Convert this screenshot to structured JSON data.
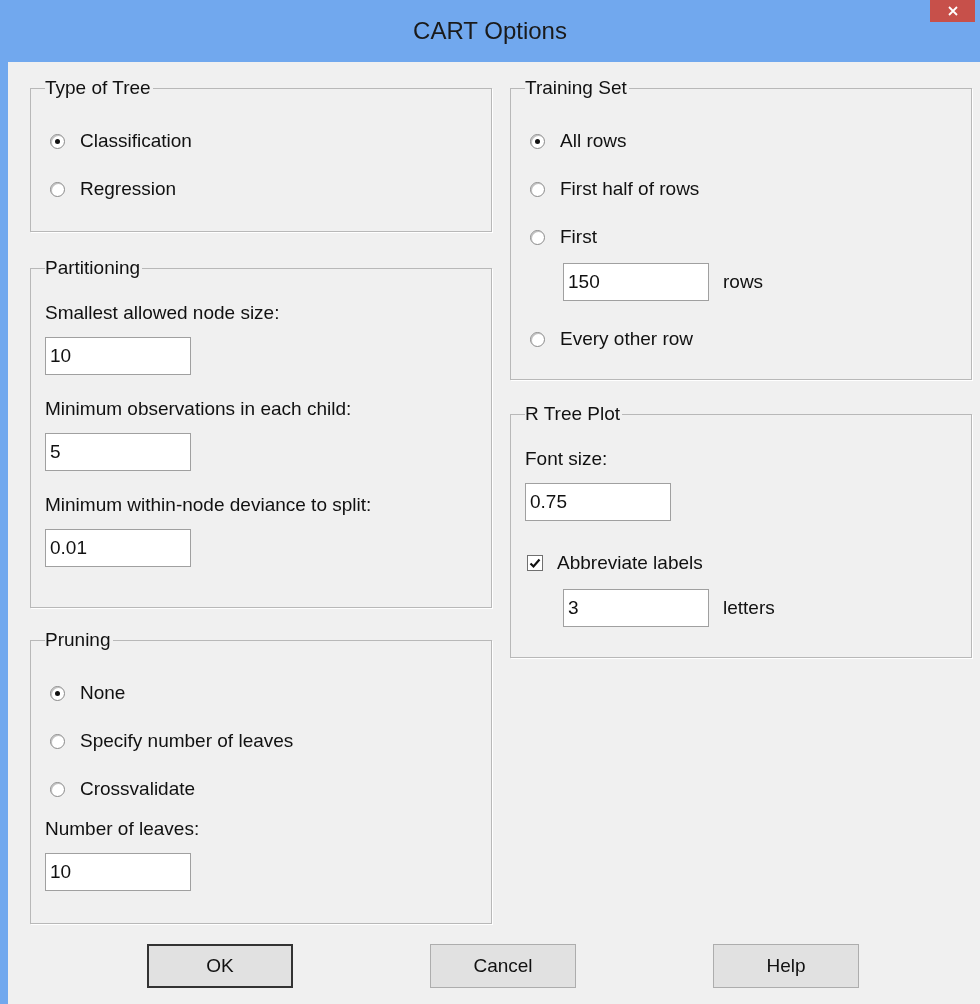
{
  "window": {
    "title": "CART Options"
  },
  "columns": [
    [
      {
        "title": "Type of Tree",
        "items": [
          {
            "kind": "radio",
            "label": "Classification",
            "selected": true
          },
          {
            "kind": "radio",
            "label": "Regression",
            "selected": false
          }
        ]
      },
      {
        "title": "Partitioning",
        "items": [
          {
            "kind": "label",
            "text": "Smallest allowed node size:"
          },
          {
            "kind": "field",
            "value": "10"
          },
          {
            "kind": "label",
            "text": "Minimum observations in each child:"
          },
          {
            "kind": "field",
            "value": "5"
          },
          {
            "kind": "label",
            "text": "Minimum within-node deviance to split:"
          },
          {
            "kind": "field",
            "value": "0.01"
          }
        ]
      },
      {
        "title": "Pruning",
        "items": [
          {
            "kind": "radio",
            "label": "None",
            "selected": true
          },
          {
            "kind": "radio",
            "label": "Specify number of leaves",
            "selected": false
          },
          {
            "kind": "radio",
            "label": "Crossvalidate",
            "selected": false
          },
          {
            "kind": "label",
            "text": "Number of leaves:"
          },
          {
            "kind": "field",
            "value": "10"
          }
        ]
      }
    ],
    [
      {
        "title": "Training Set",
        "items": [
          {
            "kind": "radio",
            "label": "All rows",
            "selected": true
          },
          {
            "kind": "radio",
            "label": "First half of rows",
            "selected": false
          },
          {
            "kind": "radio",
            "label": "First",
            "selected": false
          },
          {
            "kind": "subfield",
            "value": "150",
            "unit": "rows"
          },
          {
            "kind": "radio",
            "label": "Every other row",
            "selected": false
          }
        ]
      },
      {
        "title": "R Tree Plot",
        "items": [
          {
            "kind": "label",
            "text": "Font size:"
          },
          {
            "kind": "field",
            "value": "0.75"
          },
          {
            "kind": "checkbox",
            "label": "Abbreviate labels",
            "checked": true
          },
          {
            "kind": "subfield",
            "value": "3",
            "unit": "letters"
          }
        ]
      }
    ]
  ],
  "buttons": [
    {
      "label": "OK",
      "default": true
    },
    {
      "label": "Cancel",
      "default": false
    },
    {
      "label": "Help",
      "default": false
    }
  ]
}
